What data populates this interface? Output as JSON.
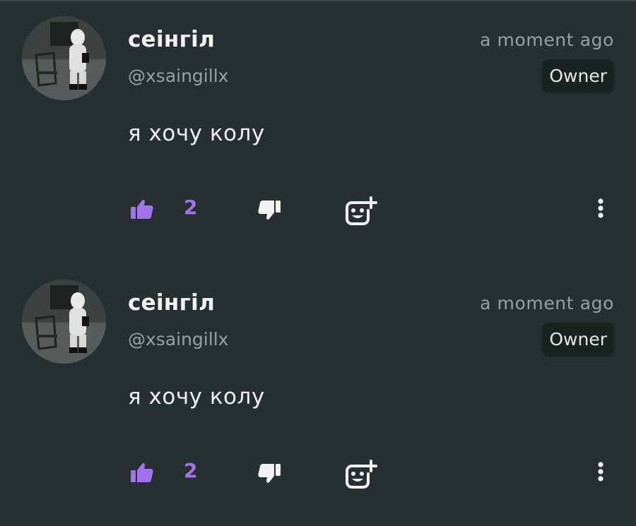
{
  "comments": [
    {
      "author_name": "сеінгіл",
      "handle": "@xsaingillx",
      "time": "a moment ago",
      "badge": "Owner",
      "text": "я хочу колу",
      "likes": "2"
    },
    {
      "author_name": "сеінгіл",
      "handle": "@xsaingillx",
      "time": "a moment ago",
      "badge": "Owner",
      "text": "я хочу колу",
      "likes": "2"
    }
  ],
  "icons": {
    "like": "thumbs-up-icon",
    "dislike": "thumbs-down-icon",
    "react": "add-reaction-icon",
    "more": "more-vertical-icon"
  },
  "colors": {
    "background": "#263030",
    "accent": "#a373ee",
    "badge_background": "#1b2222"
  }
}
